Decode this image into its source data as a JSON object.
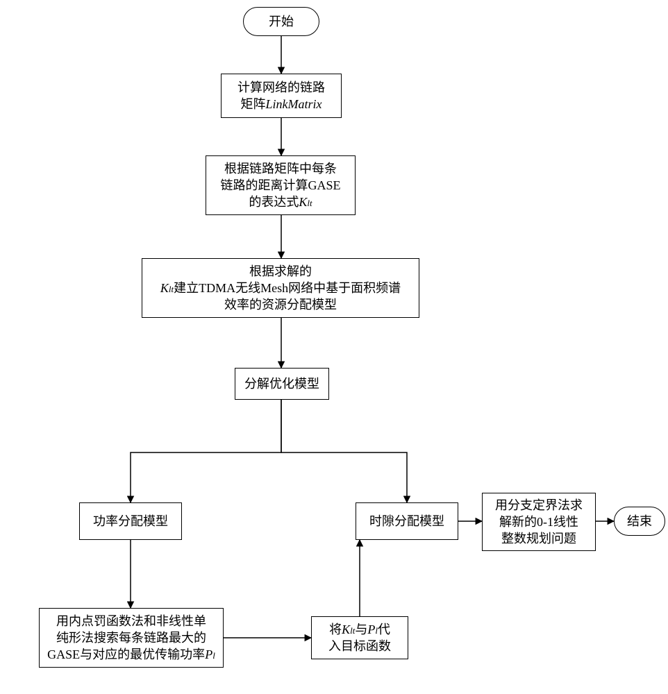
{
  "terminators": {
    "start": "开始",
    "end": "结束"
  },
  "steps": {
    "s1_l1": "计算网络的链路",
    "s1_l2_a": "矩阵",
    "s1_l2_b": "LinkMatrix",
    "s2_l1": "根据链路矩阵中每条",
    "s2_l2": "链路的距离计算GASE",
    "s2_l3_a": "的表达式",
    "s2_l3_b": "K",
    "s2_l3_c": "lt",
    "s3_l1": "根据求解的",
    "s3_l2_a": "K",
    "s3_l2_b": "lt",
    "s3_l2_c": "建立TDMA无线Mesh网络中基于面积频谱",
    "s3_l3": "效率的资源分配模型",
    "s4": "分解优化模型",
    "s5": "功率分配模型",
    "s6": "时隙分配模型",
    "s7_l1": "用内点罚函数法和非线性单",
    "s7_l2": "纯形法搜索每条链路最大的",
    "s7_l3_a": "GASE与对应的最优传输功率",
    "s7_l3_b": "P",
    "s7_l3_c": "l",
    "s8_l1_a": "将",
    "s8_l1_b": "K",
    "s8_l1_c": "lt",
    "s8_l1_d": "与",
    "s8_l1_e": "P",
    "s8_l1_f": "l",
    "s8_l1_g": "代",
    "s8_l2": "入目标函数",
    "s9_l1": "用分支定界法求",
    "s9_l2": "解新的0-1线性",
    "s9_l3": "整数规划问题"
  },
  "chart_data": {
    "type": "flowchart",
    "nodes": [
      {
        "id": "start",
        "shape": "terminator",
        "label": "开始"
      },
      {
        "id": "s1",
        "shape": "process",
        "label": "计算网络的链路矩阵LinkMatrix"
      },
      {
        "id": "s2",
        "shape": "process",
        "label": "根据链路矩阵中每条链路的距离计算GASE的表达式K_lt"
      },
      {
        "id": "s3",
        "shape": "process",
        "label": "根据求解的K_lt建立TDMA无线Mesh网络中基于面积频谱效率的资源分配模型"
      },
      {
        "id": "s4",
        "shape": "process",
        "label": "分解优化模型"
      },
      {
        "id": "s5",
        "shape": "process",
        "label": "功率分配模型"
      },
      {
        "id": "s6",
        "shape": "process",
        "label": "时隙分配模型"
      },
      {
        "id": "s7",
        "shape": "process",
        "label": "用内点罚函数法和非线性单纯形法搜索每条链路最大的GASE与对应的最优传输功率P_l"
      },
      {
        "id": "s8",
        "shape": "process",
        "label": "将K_lt与P_l代入目标函数"
      },
      {
        "id": "s9",
        "shape": "process",
        "label": "用分支定界法求解新的0-1线性整数规划问题"
      },
      {
        "id": "end",
        "shape": "terminator",
        "label": "结束"
      }
    ],
    "edges": [
      {
        "from": "start",
        "to": "s1"
      },
      {
        "from": "s1",
        "to": "s2"
      },
      {
        "from": "s2",
        "to": "s3"
      },
      {
        "from": "s3",
        "to": "s4"
      },
      {
        "from": "s4",
        "to": "s5"
      },
      {
        "from": "s4",
        "to": "s6"
      },
      {
        "from": "s5",
        "to": "s7"
      },
      {
        "from": "s7",
        "to": "s8"
      },
      {
        "from": "s8",
        "to": "s6"
      },
      {
        "from": "s6",
        "to": "s9"
      },
      {
        "from": "s9",
        "to": "end"
      }
    ]
  }
}
